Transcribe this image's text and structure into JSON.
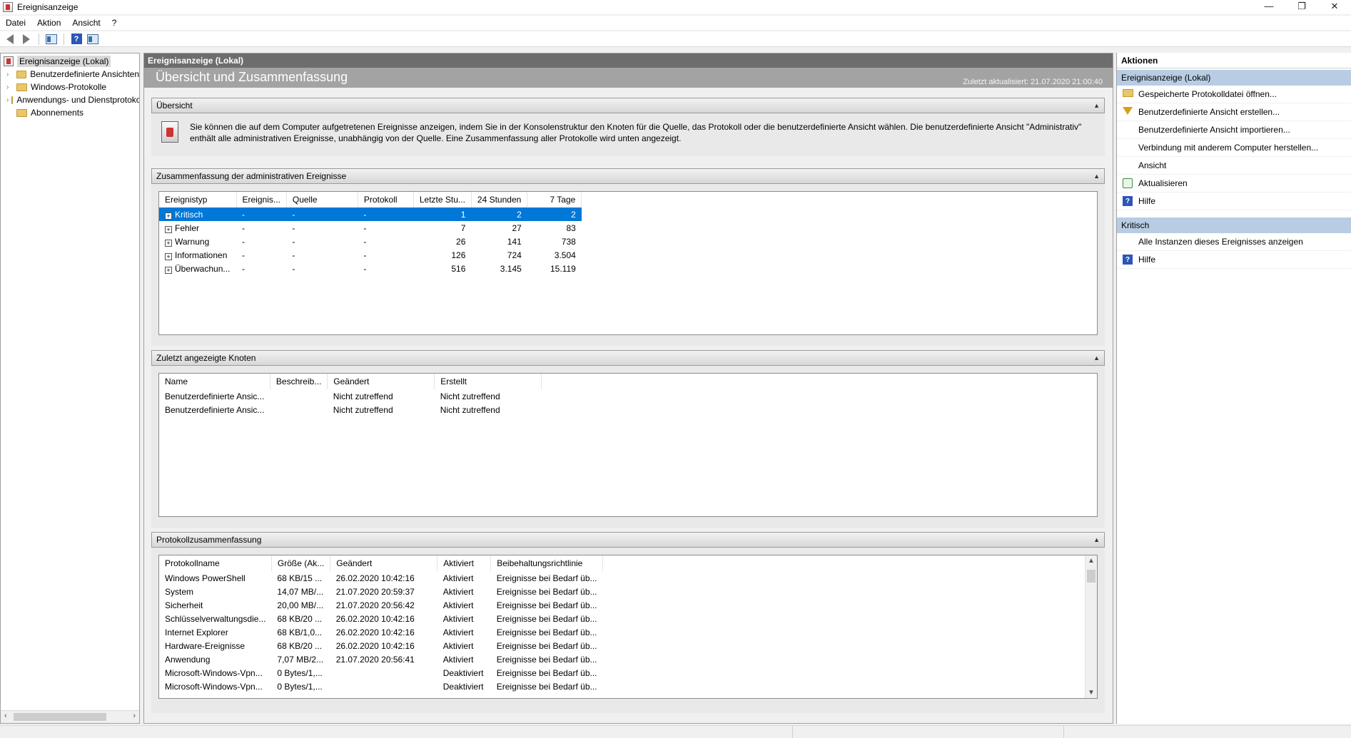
{
  "window": {
    "title": "Ereignisanzeige",
    "minimize": "—",
    "restore": "❐",
    "close": "✕"
  },
  "menu": [
    "Datei",
    "Aktion",
    "Ansicht",
    "?"
  ],
  "tree": {
    "items": [
      {
        "label": "Ereignisanzeige (Lokal)",
        "expander": ""
      },
      {
        "label": "Benutzerdefinierte Ansichten",
        "expander": "›"
      },
      {
        "label": "Windows-Protokolle",
        "expander": "›"
      },
      {
        "label": "Anwendungs- und Dienstprotokolle",
        "expander": "›"
      },
      {
        "label": "Abonnements",
        "expander": ""
      }
    ]
  },
  "center": {
    "header": "Ereignisanzeige (Lokal)",
    "banner_title": "Übersicht und Zusammenfassung",
    "updated": "Zuletzt aktualisiert: 21.07.2020 21:00:40",
    "overview": {
      "title": "Übersicht",
      "text": "Sie können die auf dem Computer aufgetretenen Ereignisse anzeigen, indem Sie in der Konsolenstruktur den Knoten für die Quelle, das Protokoll oder die benutzerdefinierte Ansicht wählen. Die benutzerdefinierte Ansicht \"Administrativ\" enthält alle administrativen Ereignisse, unabhängig von der Quelle. Eine Zusammenfassung aller Protokolle wird unten angezeigt."
    },
    "admin_summary": {
      "title": "Zusammenfassung der administrativen Ereignisse",
      "columns": [
        "Ereignistyp",
        "Ereignis...",
        "Quelle",
        "Protokoll",
        "Letzte Stu...",
        "24 Stunden",
        "7 Tage"
      ],
      "rows": [
        [
          "Kritisch",
          "-",
          "-",
          "-",
          "1",
          "2",
          "2"
        ],
        [
          "Fehler",
          "-",
          "-",
          "-",
          "7",
          "27",
          "83"
        ],
        [
          "Warnung",
          "-",
          "-",
          "-",
          "26",
          "141",
          "738"
        ],
        [
          "Informationen",
          "-",
          "-",
          "-",
          "126",
          "724",
          "3.504"
        ],
        [
          "Überwachun...",
          "-",
          "-",
          "-",
          "516",
          "3.145",
          "15.119"
        ]
      ]
    },
    "recent_nodes": {
      "title": "Zuletzt angezeigte Knoten",
      "columns": [
        "Name",
        "Beschreib...",
        "Geändert",
        "Erstellt"
      ],
      "rows": [
        [
          "Benutzerdefinierte Ansic...",
          "",
          "Nicht zutreffend",
          "Nicht zutreffend"
        ],
        [
          "Benutzerdefinierte Ansic...",
          "",
          "Nicht zutreffend",
          "Nicht zutreffend"
        ]
      ]
    },
    "log_summary": {
      "title": "Protokollzusammenfassung",
      "columns": [
        "Protokollname",
        "Größe (Ak...",
        "Geändert",
        "Aktiviert",
        "Beibehaltungsrichtlinie"
      ],
      "rows": [
        [
          "Windows PowerShell",
          "68 KB/15 ...",
          "26.02.2020 10:42:16",
          "Aktiviert",
          "Ereignisse bei Bedarf üb..."
        ],
        [
          "System",
          "14,07 MB/...",
          "21.07.2020 20:59:37",
          "Aktiviert",
          "Ereignisse bei Bedarf üb..."
        ],
        [
          "Sicherheit",
          "20,00 MB/...",
          "21.07.2020 20:56:42",
          "Aktiviert",
          "Ereignisse bei Bedarf üb..."
        ],
        [
          "Schlüsselverwaltungsdie...",
          "68 KB/20 ...",
          "26.02.2020 10:42:16",
          "Aktiviert",
          "Ereignisse bei Bedarf üb..."
        ],
        [
          "Internet Explorer",
          "68 KB/1,0...",
          "26.02.2020 10:42:16",
          "Aktiviert",
          "Ereignisse bei Bedarf üb..."
        ],
        [
          "Hardware-Ereignisse",
          "68 KB/20 ...",
          "26.02.2020 10:42:16",
          "Aktiviert",
          "Ereignisse bei Bedarf üb..."
        ],
        [
          "Anwendung",
          "7,07 MB/2...",
          "21.07.2020 20:56:41",
          "Aktiviert",
          "Ereignisse bei Bedarf üb..."
        ],
        [
          "Microsoft-Windows-Vpn...",
          "0 Bytes/1,...",
          "",
          "Deaktiviert",
          "Ereignisse bei Bedarf üb..."
        ],
        [
          "Microsoft-Windows-Vpn...",
          "0 Bytes/1,...",
          "",
          "Deaktiviert",
          "Ereignisse bei Bedarf üb..."
        ]
      ]
    }
  },
  "actions": {
    "title": "Aktionen",
    "group1": "Ereignisanzeige (Lokal)",
    "group1_items": [
      {
        "label": "Gespeicherte Protokolldatei öffnen...",
        "icon": "folder-open-icon"
      },
      {
        "label": "Benutzerdefinierte Ansicht erstellen...",
        "icon": "filter-icon"
      },
      {
        "label": "Benutzerdefinierte Ansicht importieren...",
        "icon": ""
      },
      {
        "label": "Verbindung mit anderem Computer herstellen...",
        "icon": ""
      },
      {
        "label": "Ansicht",
        "icon": ""
      },
      {
        "label": "Aktualisieren",
        "icon": "refresh-icon"
      },
      {
        "label": "Hilfe",
        "icon": "help-icon"
      }
    ],
    "group2": "Kritisch",
    "group2_items": [
      {
        "label": "Alle Instanzen dieses Ereignisses anzeigen",
        "icon": ""
      },
      {
        "label": "Hilfe",
        "icon": "help-icon"
      }
    ]
  },
  "colors": {
    "selection": "#0078d7",
    "header_dark": "#6d6d6d",
    "banner": "#a3a3a3",
    "action_group": "#b8cde3"
  }
}
